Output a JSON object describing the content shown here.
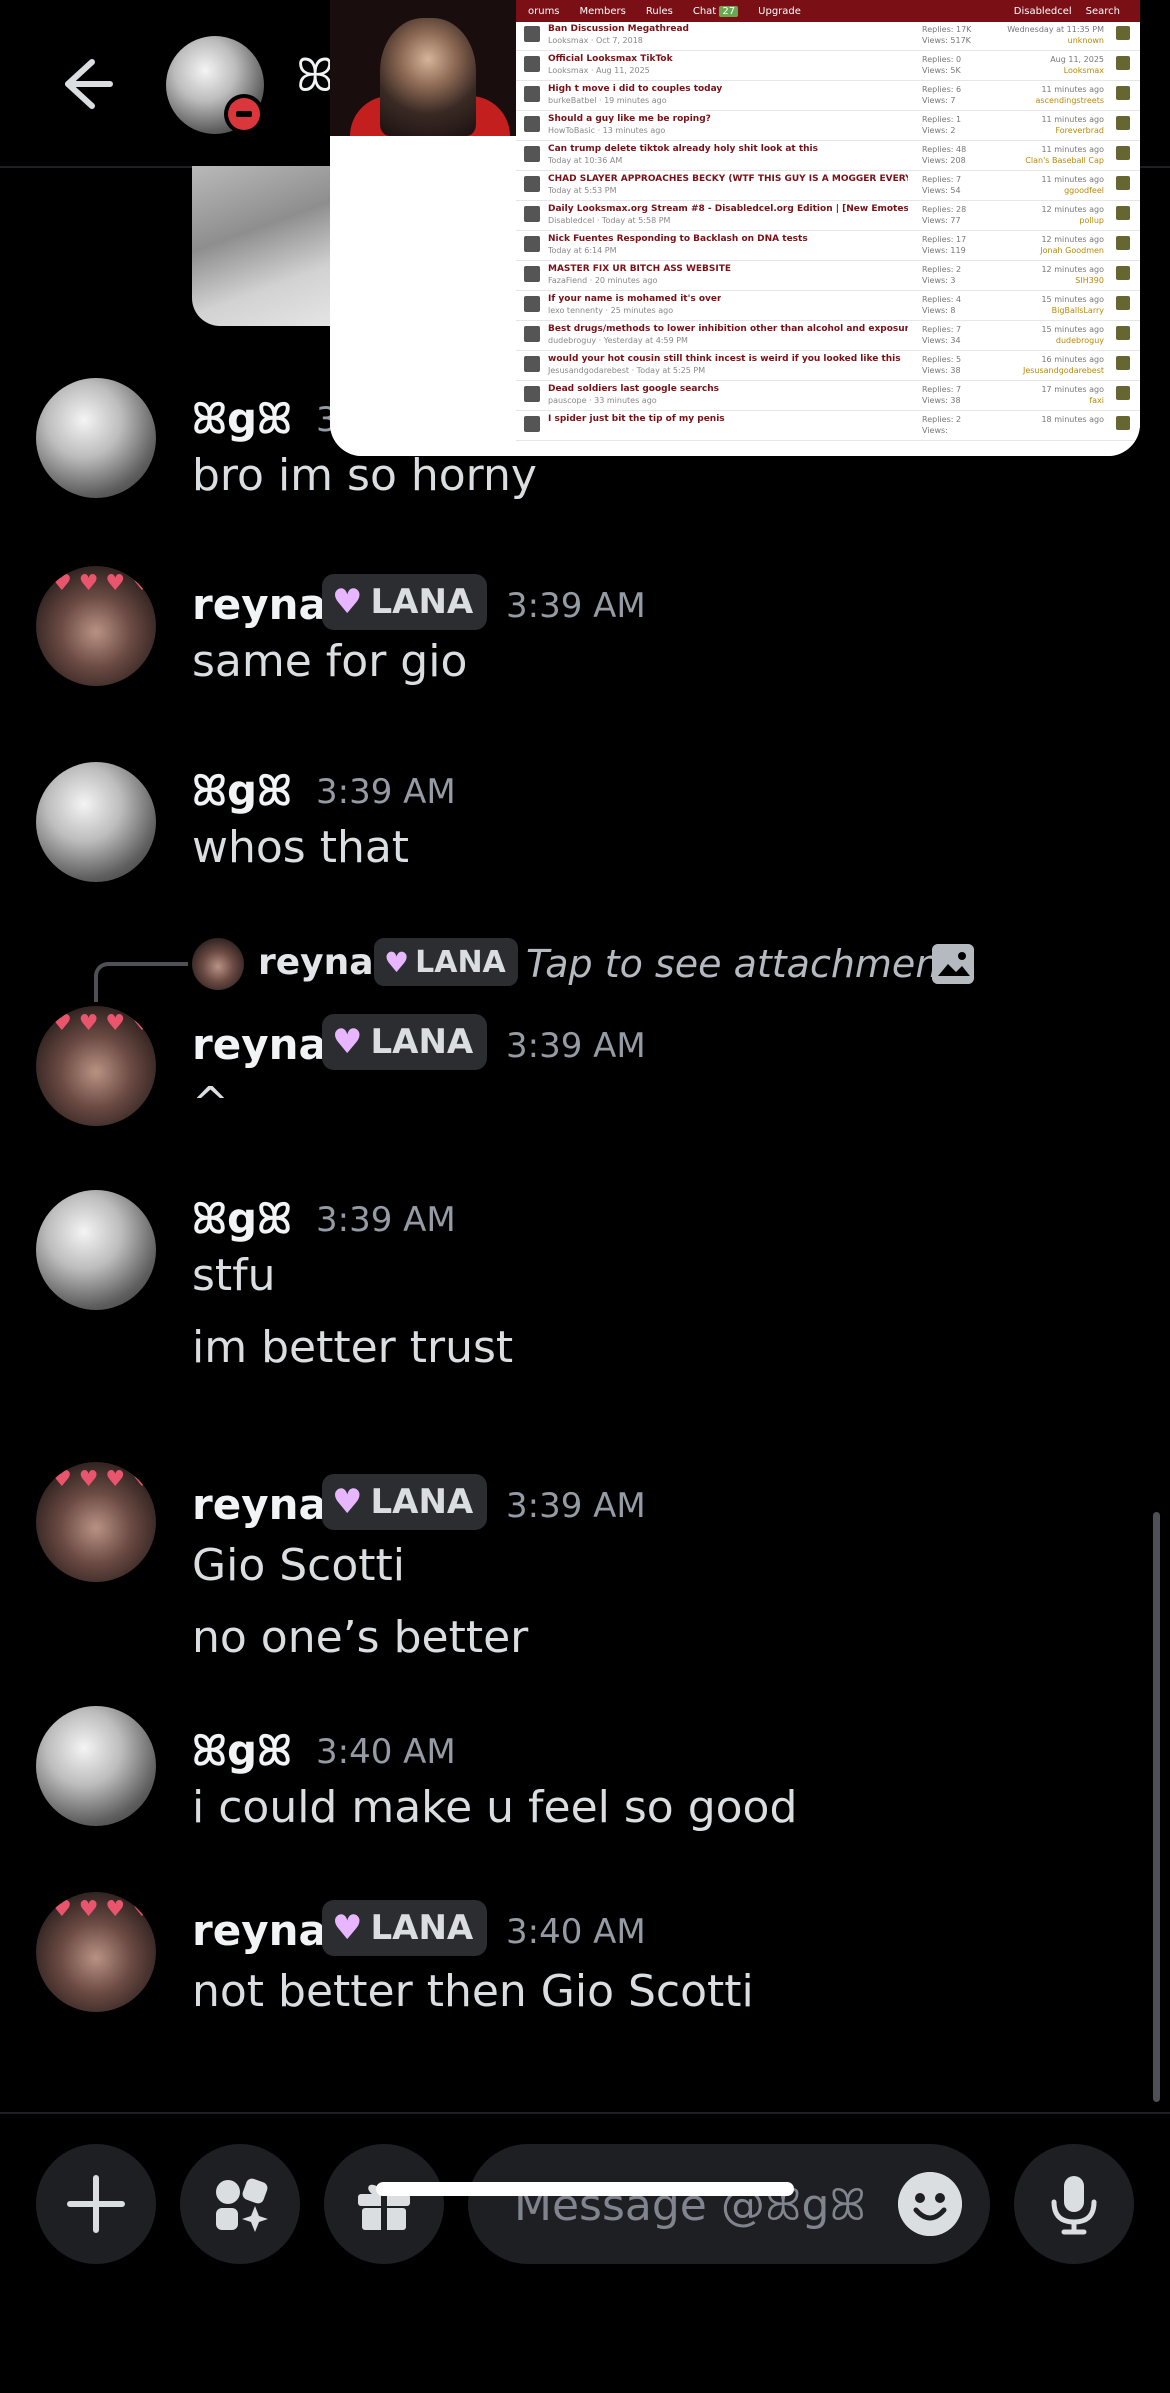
{
  "header": {
    "back_label": "Back",
    "contact_name_stub": "ꕤ"
  },
  "pip": {
    "nav": [
      "orums",
      "Members",
      "Rules",
      "Chat",
      "Upgrade"
    ],
    "chat_count": "27",
    "nav_right": [
      "Disabledcel",
      "Search"
    ],
    "threads": [
      {
        "title": "Ban Discussion Megathread",
        "meta": "Looksmax · Oct 7, 2018",
        "replies": "17K",
        "views": "517K",
        "last": "Wednesday at 11:35 PM",
        "last_user": "unknown"
      },
      {
        "title": "Official Looksmax TikTok",
        "meta": "Looksmax · Aug 11, 2025",
        "replies": "0",
        "views": "5K",
        "last": "Aug 11, 2025",
        "last_user": "Looksmax"
      },
      {
        "title": "High t move i did to couples today",
        "meta": "burkeBatbel · 19 minutes ago",
        "replies": "6",
        "views": "7",
        "last": "11 minutes ago",
        "last_user": "ascendingstreets"
      },
      {
        "title": "Should a guy like me be roping?",
        "meta": "HowToBasic · 13 minutes ago",
        "replies": "1",
        "views": "2",
        "last": "11 minutes ago",
        "last_user": "Foreverbrad"
      },
      {
        "title": "Can trump delete tiktok already holy shit look at this",
        "meta": "Today at 10:36 AM",
        "replies": "48",
        "views": "208",
        "last": "11 minutes ago",
        "last_user": "Clan's Baseball Cap"
      },
      {
        "title": "CHAD SLAYER APPROACHES BECKY (WTF THIS GUY IS A MOGGER EVERY MEMBER GTFIH)",
        "meta": "Today at 5:53 PM",
        "replies": "7",
        "views": "54",
        "last": "11 minutes ago",
        "last_user": "ggoodfeel"
      },
      {
        "title": "Daily Looksmax.org Stream #8 - Disabledcel.org Edition | [New Emotes]",
        "meta": "Disabledcel · Today at 5:58 PM",
        "replies": "28",
        "views": "77",
        "last": "12 minutes ago",
        "last_user": "pollup"
      },
      {
        "title": "Nick Fuentes Responding to Backlash on DNA tests",
        "meta": "Today at 6:14 PM",
        "replies": "17",
        "views": "119",
        "last": "12 minutes ago",
        "last_user": "Jonah Goodmen"
      },
      {
        "title": "MASTER FIX UR BITCH ASS WEBSITE",
        "meta": "FazaFiend · 20 minutes ago",
        "replies": "2",
        "views": "3",
        "last": "12 minutes ago",
        "last_user": "SIH390"
      },
      {
        "title": "If your name is mohamed it's over",
        "meta": "lexo tennenty · 25 minutes ago",
        "replies": "4",
        "views": "8",
        "last": "15 minutes ago",
        "last_user": "BigBallsLarry"
      },
      {
        "title": "Best drugs/methods to lower inhibition other than alcohol and exposure therapy",
        "meta": "dudebroguy · Yesterday at 4:59 PM",
        "replies": "7",
        "views": "34",
        "last": "15 minutes ago",
        "last_user": "dudebroguy"
      },
      {
        "title": "would your hot cousin still think incest is weird if you looked like this",
        "meta": "Jesusandgodarebest · Today at 5:25 PM",
        "replies": "5",
        "views": "38",
        "last": "16 minutes ago",
        "last_user": "Jesusandgodarebest"
      },
      {
        "title": "Dead soldiers last google searchs",
        "meta": "pauscope · 33 minutes ago",
        "replies": "7",
        "views": "38",
        "last": "17 minutes ago",
        "last_user": "faxi"
      },
      {
        "title": "I spider just bit the tip of my penis",
        "meta": "",
        "replies": "2",
        "views": "",
        "last": "18 minutes ago",
        "last_user": ""
      }
    ]
  },
  "messages": [
    {
      "author": "ꕤgꕤ",
      "time": "3:",
      "text": [
        "bro im so horny"
      ]
    },
    {
      "author": "reyna",
      "tag": "LANA",
      "time": "3:39 AM",
      "text": [
        "same for gio"
      ]
    },
    {
      "author": "ꕤgꕤ",
      "time": "3:39 AM",
      "text": [
        "whos that"
      ]
    },
    {
      "author": "reyna",
      "tag": "LANA",
      "time": "3:39 AM",
      "text": [
        "^"
      ],
      "reply": {
        "author": "reyna",
        "tag": "LANA",
        "text": "Tap to see attachment"
      }
    },
    {
      "author": "ꕤgꕤ",
      "time": "3:39 AM",
      "text": [
        "stfu",
        "im better trust"
      ]
    },
    {
      "author": "reyna",
      "tag": "LANA",
      "time": "3:39 AM",
      "text": [
        "Gio Scotti",
        "no one’s better"
      ]
    },
    {
      "author": "ꕤgꕤ",
      "time": "3:40 AM",
      "text": [
        "i could make u feel so good"
      ]
    },
    {
      "author": "reyna",
      "tag": "LANA",
      "time": "3:40 AM",
      "text": [
        "not better then Gio Scotti"
      ]
    }
  ],
  "composer": {
    "placeholder": "Message @ꕤgꕤ",
    "buttons": [
      "add-icon",
      "apps-icon",
      "gift-icon",
      "emoji-icon",
      "microphone-icon"
    ]
  },
  "colors": {
    "background": "#000000",
    "tag_bg": "#2b2d31",
    "timestamp": "#949ba4",
    "dnd": "#da373c",
    "forum_red": "#7a1016"
  }
}
